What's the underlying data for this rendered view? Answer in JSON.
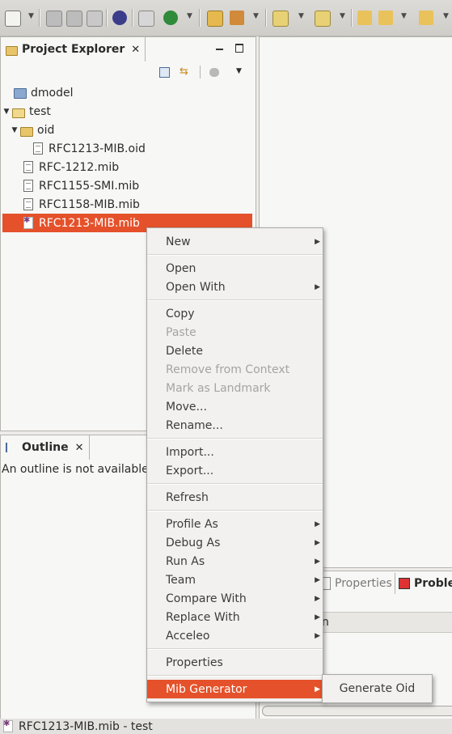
{
  "toolbar": {
    "icons": [
      "new-wizard-icon",
      "save-icon",
      "save-all-icon",
      "print-icon",
      "generate-icon",
      "open-type-icon",
      "debug-run-icon",
      "open-folder-icon",
      "tools-icon",
      "next-annotation-icon",
      "prev-annotation-icon",
      "back-icon",
      "forward-icon"
    ]
  },
  "project_explorer": {
    "title": "Project Explorer",
    "close_glyph": "✕",
    "tree": [
      {
        "label": "dmodel",
        "depth": 0,
        "kind": "project"
      },
      {
        "label": "test",
        "depth": 0,
        "kind": "open-project",
        "expanded": true
      },
      {
        "label": "oid",
        "depth": 1,
        "kind": "folder",
        "expanded": true
      },
      {
        "label": "RFC1213-MIB.oid",
        "depth": 2,
        "kind": "file"
      },
      {
        "label": "RFC-1212.mib",
        "depth": 1,
        "kind": "file"
      },
      {
        "label": "RFC1155-SMI.mib",
        "depth": 1,
        "kind": "file"
      },
      {
        "label": "RFC1158-MIB.mib",
        "depth": 1,
        "kind": "file"
      },
      {
        "label": "RFC1213-MIB.mib",
        "depth": 1,
        "kind": "mib-file",
        "selected": true
      }
    ]
  },
  "outline": {
    "title": "Outline",
    "close_glyph": "✕",
    "message": "An outline is not available."
  },
  "bottom_panel": {
    "tab_properties": "Properties",
    "tab_problems": "Problen",
    "column_fragment": "n"
  },
  "context_menu": {
    "items": [
      {
        "label": "New",
        "sub": true
      },
      {
        "label": "Open"
      },
      {
        "label": "Open With",
        "sub": true
      },
      {
        "label": "Copy"
      },
      {
        "label": "Paste",
        "disabled": true
      },
      {
        "label": "Delete"
      },
      {
        "label": "Remove from Context",
        "disabled": true
      },
      {
        "label": "Mark as Landmark",
        "disabled": true
      },
      {
        "label": "Move..."
      },
      {
        "label": "Rename..."
      },
      {
        "label": "Import..."
      },
      {
        "label": "Export..."
      },
      {
        "label": "Refresh"
      },
      {
        "label": "Profile As",
        "sub": true
      },
      {
        "label": "Debug As",
        "sub": true
      },
      {
        "label": "Run As",
        "sub": true
      },
      {
        "label": "Team",
        "sub": true
      },
      {
        "label": "Compare With",
        "sub": true
      },
      {
        "label": "Replace With",
        "sub": true
      },
      {
        "label": "Acceleo",
        "sub": true
      },
      {
        "label": "Properties"
      },
      {
        "label": "Mib Generator",
        "sub": true,
        "highlighted": true
      }
    ],
    "submenu_glyph": "▶"
  },
  "submenu": {
    "label": "Generate Oid"
  },
  "status_bar": {
    "text": "RFC1213-MIB.mib - test"
  },
  "colors": {
    "selection": "#e5512a",
    "panel_bg": "#f7f7f6",
    "chrome_bg": "#edecea"
  }
}
